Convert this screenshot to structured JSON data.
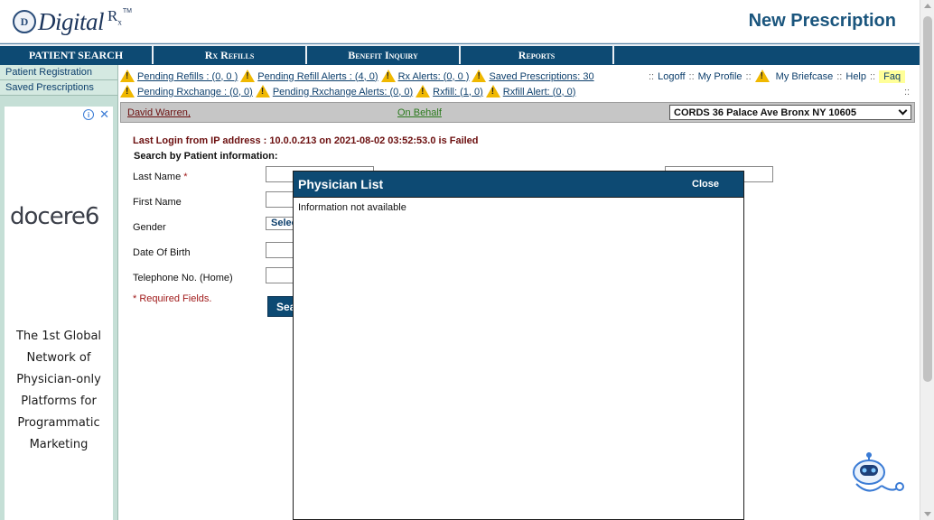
{
  "header": {
    "logo_mark": "D",
    "logo_text": "Digital",
    "logo_rx": "R",
    "logo_rx_sub": "x",
    "logo_tm": "TM",
    "page_title": "New Prescription"
  },
  "nav": {
    "items": [
      {
        "label": "PATIENT SEARCH"
      },
      {
        "label": "Rx Refills"
      },
      {
        "label": "Benefit Inquiry"
      },
      {
        "label": "Reports"
      }
    ]
  },
  "sidebar": {
    "links": [
      {
        "label": "Patient Registration"
      },
      {
        "label": "Saved Prescriptions"
      }
    ],
    "ad": {
      "info": "i",
      "close": "✕",
      "brand": "docere",
      "brand_mark": "6",
      "copy_lines": [
        "The 1st Global",
        "Network of",
        "Physician-only",
        "Platforms for",
        "Programmatic",
        "Marketing"
      ]
    }
  },
  "alerts": {
    "row1": [
      {
        "label": "Pending Refills : (0, 0 )",
        "icon": "warning-icon"
      },
      {
        "label": "Pending Refill Alerts : (4, 0)",
        "icon": "warning-icon"
      },
      {
        "label": "Rx Alerts: (0, 0 )",
        "icon": "warning-icon"
      },
      {
        "label": "Saved Prescriptions: 30",
        "icon": "warning-icon"
      }
    ],
    "row2": [
      {
        "label": "Pending Rxchange : (0, 0)",
        "icon": "warning-icon"
      },
      {
        "label": "Pending Rxchange Alerts: (0, 0)",
        "icon": "warning-icon"
      },
      {
        "label": "Rxfill: (1, 0)",
        "icon": "warning-icon"
      },
      {
        "label": "Rxfill Alert: (0, 0)",
        "icon": "warning-icon"
      }
    ]
  },
  "toplinks": {
    "sep": "::",
    "logoff": "Logoff",
    "my_profile": "My Profile",
    "my_briefcase": "My Briefcase",
    "help": "Help",
    "faq": "Faq"
  },
  "patient_bar": {
    "name": "David Warren,",
    "on_behalf": "On Behalf",
    "location": "CORDS 36 Palace Ave Bronx NY 10605"
  },
  "main": {
    "last_login": "Last Login from IP address : 10.0.0.213 on 2021-08-02 03:52:53.0 is Failed",
    "search_by": "Search by Patient information:",
    "fields": {
      "last_name": "Last Name",
      "asterisk": "*",
      "first_name": "First Name",
      "gender": "Gender",
      "gender_value": "Select",
      "dob": "Date Of Birth",
      "phone": "Telephone No. (Home)"
    },
    "required_note": "* Required Fields.",
    "search_button": "Search"
  },
  "modal": {
    "title": "Physician List",
    "close": "Close",
    "body": "Information not available"
  },
  "colors": {
    "brand_blue": "#0d4a73",
    "sidebar_green": "#c5dfd6",
    "alert_yellow": "#f0b800",
    "error_red": "#6b0e0e"
  }
}
